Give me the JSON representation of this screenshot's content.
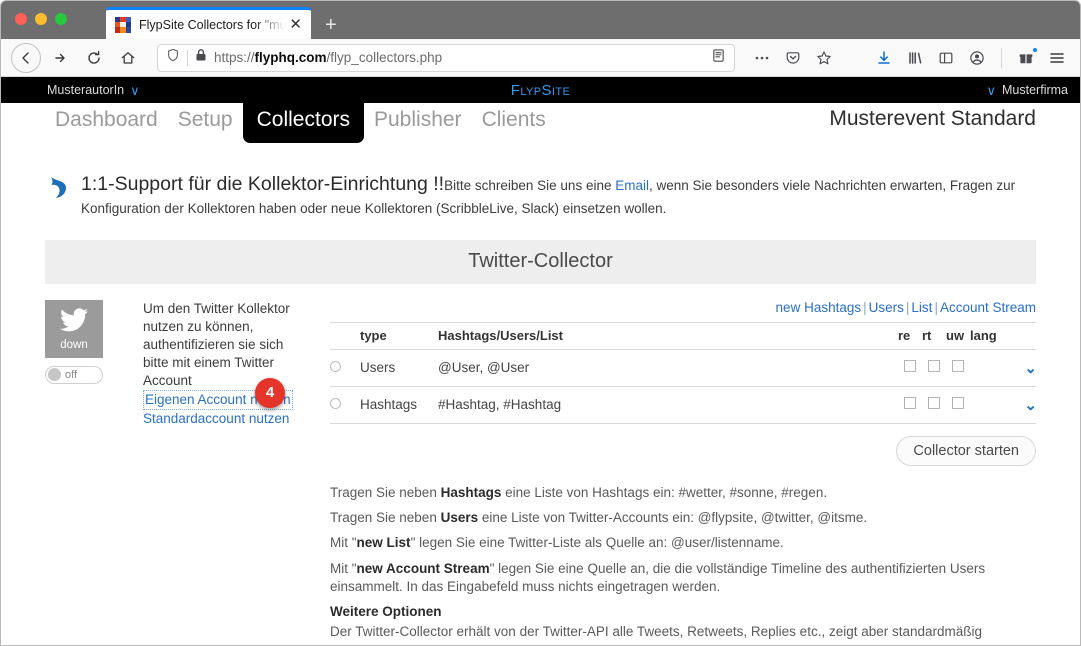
{
  "browser": {
    "tab_title": "FlypSite Collectors for \"musterf",
    "tab_close": "✕",
    "new_tab": "+",
    "url_display_host": "flyphq.com",
    "url_prefix": "https://",
    "url_path": "/flyp_collectors.php",
    "url_full": "https://flyphq.com/flyp_collectors.php"
  },
  "site": {
    "topbar": {
      "user": "MusterautorIn",
      "user_chevron": "∨",
      "brand": "FlypSite",
      "company_chevron": "∨",
      "company": "Musterfirma"
    },
    "nav": {
      "items": [
        {
          "label": "Dashboard",
          "active": false
        },
        {
          "label": "Setup",
          "active": false
        },
        {
          "label": "Collectors",
          "active": true
        },
        {
          "label": "Publisher",
          "active": false
        },
        {
          "label": "Clients",
          "active": false
        }
      ],
      "event_name": "Musterevent Standard"
    },
    "support": {
      "headline": "1:1-Support für die Kollektor-Einrichtung !!",
      "text_before": "Bitte schreiben Sie uns eine ",
      "link": "Email",
      "text_after": ", wenn Sie besonders viele Nachrichten erwarten, Fragen zur Konfiguration der Kollektoren haben oder neue Kollektoren (ScribbleLive, Slack) einsetzen wollen."
    },
    "section_title": "Twitter-Collector",
    "collector": {
      "status_label": "down",
      "toggle_label": "off",
      "description": "Um den Twitter Kollektor nutzen zu können, authentifizieren sie sich bitte mit einem Twitter Account",
      "link_own_account": "Eigenen Account nutzen",
      "link_standard_account": "Standardaccount nutzen",
      "badge": "4",
      "new_links": {
        "prefix": "new",
        "hashtags": "Hashtags",
        "users": "Users",
        "list": "List",
        "account_stream": "Account Stream",
        "separator": "|"
      },
      "table": {
        "headers": {
          "type": "type",
          "value": "Hashtags/Users/List",
          "re": "re",
          "rt": "rt",
          "uw": "uw",
          "lang": "lang"
        },
        "rows": [
          {
            "type": "Users",
            "placeholder": "@User, @User"
          },
          {
            "type": "Hashtags",
            "placeholder": "#Hashtag, #Hashtag"
          }
        ]
      },
      "start_button": "Collector starten"
    },
    "help": {
      "line1_a": "Tragen Sie neben ",
      "line1_b": "Hashtags",
      "line1_c": " eine Liste von Hashtags ein: #wetter, #sonne, #regen.",
      "line2_a": "Tragen Sie neben ",
      "line2_b": "Users",
      "line2_c": " eine Liste von Twitter-Accounts ein: @flypsite, @twitter, @itsme.",
      "line3_a": "Mit \"",
      "line3_b": "new List",
      "line3_c": "\" legen Sie eine Twitter-Liste als Quelle an: @user/listenname.",
      "line4_a": "Mit \"",
      "line4_b": "new Account Stream",
      "line4_c": "\" legen Sie eine Quelle an, die die vollständige Timeline des authentifizierten Users einsammelt. In das Eingabefeld muss nichts eingetragen werden.",
      "options_heading": "Weitere Optionen",
      "options_text": "Der Twitter-Collector erhält von der Twitter-API alle Tweets, Retweets, Replies etc., zeigt aber standardmäßig"
    }
  },
  "colors": {
    "brand_blue": "#3399ee",
    "link_blue": "#2a6fc9",
    "badge_red": "#e5342a",
    "topbar_black": "#000000",
    "section_gray": "#eeeeee"
  }
}
